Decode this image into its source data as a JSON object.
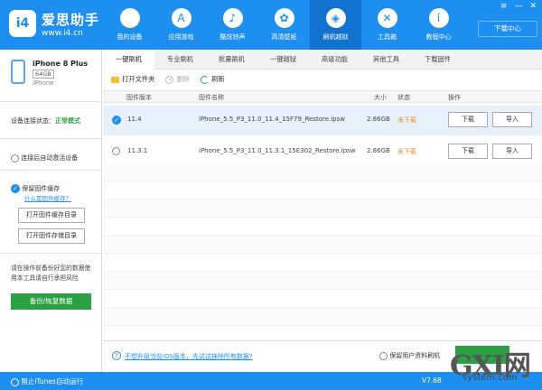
{
  "header": {
    "logo_text": "i4",
    "brand_name": "爱思助手",
    "brand_url": "www.i4.cn",
    "download_center": "下载中心",
    "nav": [
      {
        "label": "我的设备",
        "icon": "apple-icon",
        "glyph": ""
      },
      {
        "label": "应用游戏",
        "icon": "app-store-icon",
        "glyph": "A"
      },
      {
        "label": "酷炫铃声",
        "icon": "bell-icon",
        "glyph": "♪"
      },
      {
        "label": "高清壁纸",
        "icon": "flower-icon",
        "glyph": "✿"
      },
      {
        "label": "刷机越狱",
        "icon": "dropbox-icon",
        "glyph": "◈"
      },
      {
        "label": "工具箱",
        "icon": "tools-icon",
        "glyph": "✕"
      },
      {
        "label": "教程中心",
        "icon": "info-icon",
        "glyph": "i"
      }
    ],
    "active_nav": 4
  },
  "device": {
    "name": "iPhone 8 Plus",
    "capacity": "64GB",
    "type": "iPhone"
  },
  "sidebar": {
    "conn_label": "设备连接状态：",
    "conn_mode": "正常模式",
    "auto_activate": "连接后自动激活设备",
    "keep_cache": "保留固件缓存",
    "what_cache": "什么是固件缓存？",
    "open_cache_dir": "打开固件缓存目录",
    "open_store_dir": "打开固件存储目录",
    "backup_note": "请在操作前备份好您的数据使用本工具请自行承担风险",
    "backup_btn": "备份/恢复数据"
  },
  "tabs": [
    "一键刷机",
    "专业刷机",
    "批量刷机",
    "一键越狱",
    "高级功能",
    "其他工具",
    "下载固件"
  ],
  "toolbar": {
    "open_folder": "打开文件夹",
    "delete": "删除",
    "refresh": "刷新"
  },
  "table": {
    "headers": {
      "version": "固件版本",
      "name": "固件名称",
      "size": "大小",
      "status": "状态",
      "action": "操作"
    },
    "rows": [
      {
        "version": "11.4",
        "name": "iPhone_5.5_P3_11.0_11.4_15F79_Restore.ipsw",
        "size": "2.86GB",
        "status": "未下载",
        "download": "下载",
        "import": "导入"
      },
      {
        "version": "11.3.1",
        "name": "iPhone_5.5_P3_11.0_11.3.1_15E302_Restore.ipsw",
        "size": "2.86GB",
        "status": "未下载",
        "download": "下载",
        "import": "导入"
      }
    ]
  },
  "bottom": {
    "upgrade_link": "不想升级当前iOS版本，先试试抹除所有数据?",
    "keep_data": "保留用户资料刷机"
  },
  "statusbar": {
    "block_itunes": "阻止iTunes自动运行",
    "version": "V7.68"
  },
  "watermark": {
    "text": "GXI网",
    "sub": "system.com"
  }
}
